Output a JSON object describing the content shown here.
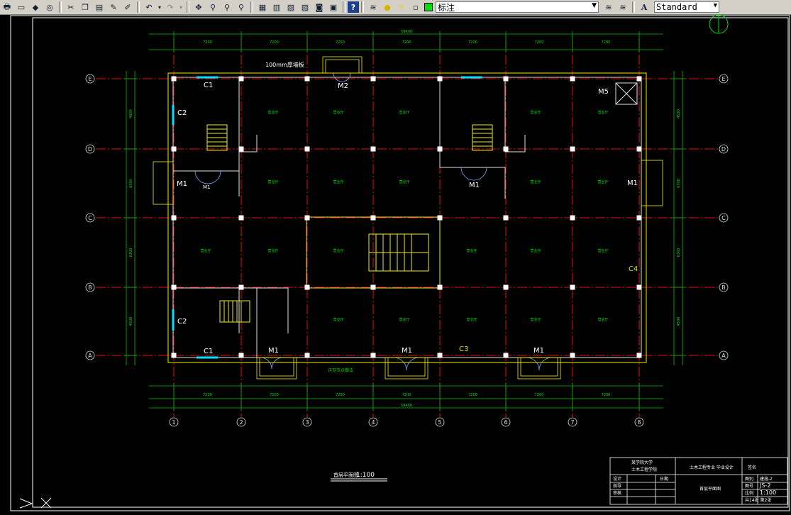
{
  "toolbar": {
    "layer_value": "标注",
    "text_style_value": "Standard"
  },
  "plan": {
    "grid_columns": [
      "1",
      "2",
      "3",
      "4",
      "5",
      "6",
      "7",
      "8"
    ],
    "grid_rows": [
      "A",
      "B",
      "C",
      "D",
      "E"
    ],
    "doors": [
      "M1",
      "M1",
      "M1",
      "M1",
      "M1",
      "M1",
      "M1",
      "M2",
      "M5"
    ],
    "windows": [
      "C1",
      "C1",
      "C2",
      "C2",
      "C3",
      "C4"
    ],
    "notes": [
      "100mm厚墙板",
      "详见节点做法"
    ],
    "dims_top_total": "58400",
    "dims_bottom_total": "58400",
    "dims_bays": [
      "7200",
      "7200",
      "7200",
      "7200",
      "7200",
      "7200",
      "7200"
    ],
    "dims_rows": [
      "4500",
      "6300",
      "6300",
      "4500"
    ],
    "room_label": "营业厅",
    "drawing_title": "首层平面图",
    "drawing_scale": "1:100"
  },
  "title_block": {
    "school": "某学院大学",
    "dept": "土木工程学院",
    "project": "土木工程专业  毕业设计",
    "drawing_name": "首层平面图",
    "role_1": "设计",
    "role_2": "指导",
    "role_3": "审核",
    "label_drawing": "图别",
    "value_drawing": "建施-2",
    "label_number": "图号",
    "value_number": "JS-2",
    "label_scale": "比例",
    "value_scale": "1:100",
    "sheets": "共14张  第2张",
    "date_label": "日期",
    "col_label": "签名"
  }
}
